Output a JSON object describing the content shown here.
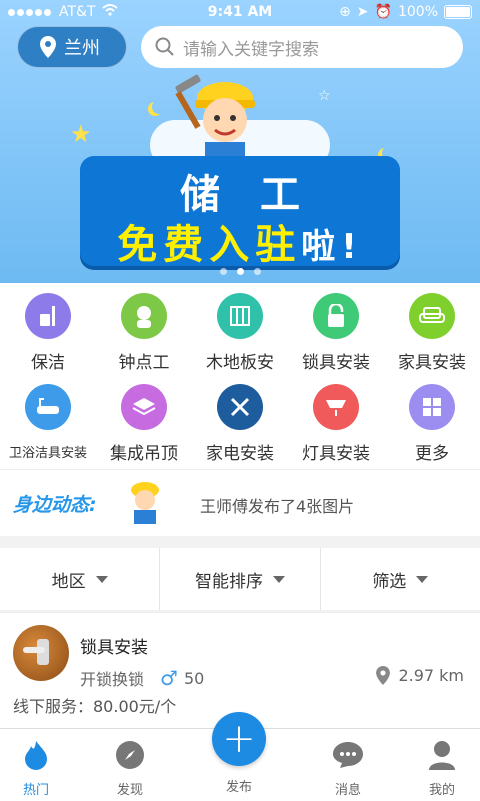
{
  "status_bar": {
    "carrier": "AT&T",
    "time": "9:41 AM",
    "battery": "100%"
  },
  "header": {
    "location": "兰州",
    "search_placeholder": "请输入关键字搜索"
  },
  "banner": {
    "line1": "储工",
    "line2_main": "免费入驻",
    "line2_tail": "啦!",
    "pages": 3,
    "active_page": 2
  },
  "categories": [
    {
      "label": "保洁",
      "icon": "cleaning-icon",
      "color": "#8e7bea"
    },
    {
      "label": "钟点工",
      "icon": "hourly-worker-icon",
      "color": "#7dc847"
    },
    {
      "label": "木地板安",
      "icon": "floor-icon",
      "color": "#2fc1a9"
    },
    {
      "label": "锁具安装",
      "icon": "lock-icon",
      "color": "#3fca77"
    },
    {
      "label": "家具安装",
      "icon": "sofa-icon",
      "color": "#7fcf2d"
    },
    {
      "label": "卫浴洁具安装",
      "icon": "bathtub-icon",
      "color": "#3d9be9"
    },
    {
      "label": "集成吊顶",
      "icon": "ceiling-icon",
      "color": "#c66be0"
    },
    {
      "label": "家电安装",
      "icon": "tools-icon",
      "color": "#1d5d9d"
    },
    {
      "label": "灯具安装",
      "icon": "lamp-icon",
      "color": "#f05a5a"
    },
    {
      "label": "更多",
      "icon": "more-icon",
      "color": "#9b8ef0"
    }
  ],
  "nearby": {
    "tag": "身边动态:",
    "text": "王师傅发布了4张图片"
  },
  "filters": [
    {
      "label": "地区"
    },
    {
      "label": "智能排序"
    },
    {
      "label": "筛选"
    }
  ],
  "listing": {
    "title": "锁具安装",
    "subtitle": "开锁换锁",
    "gender_symbol": "♂",
    "count": "50",
    "distance": "2.97 km",
    "price": "线下服务：80.00元/个"
  },
  "tabbar": {
    "hot": "热门",
    "discover": "发现",
    "publish": "发布",
    "messages": "消息",
    "mine": "我的"
  }
}
